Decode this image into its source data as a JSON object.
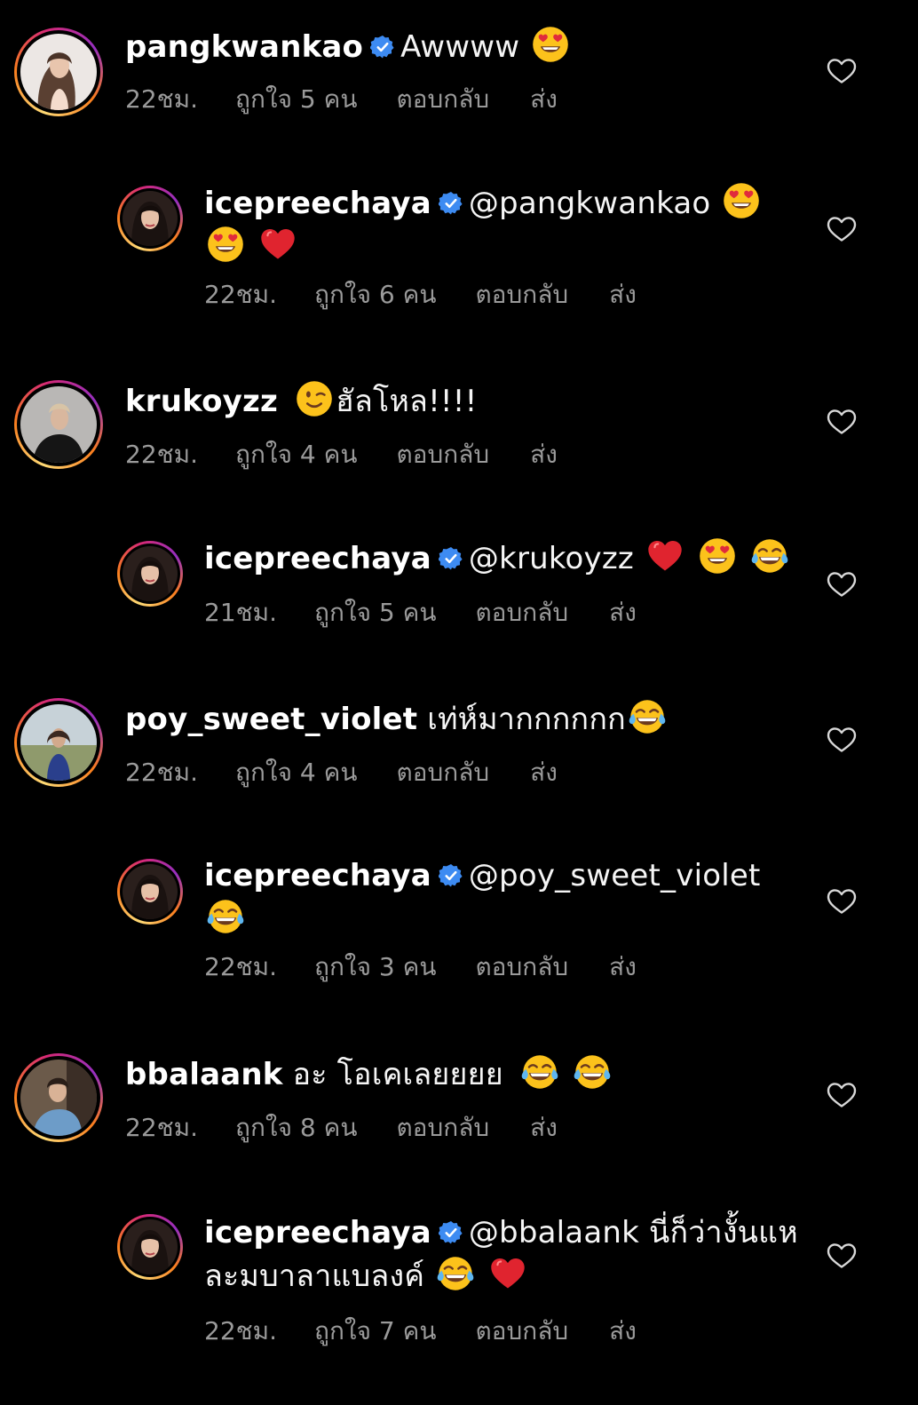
{
  "comments": [
    {
      "username": "pangkwankao",
      "verified": true,
      "text": "Awwww",
      "emojis_after": [
        "heart-eyes"
      ],
      "time": "22ชม.",
      "likes": "ถูกใจ 5 คน",
      "reply": "ตอบกลับ",
      "send": "ส่ง"
    },
    {
      "username": "icepreechaya",
      "verified": true,
      "text": "@pangkwankao",
      "emojis_after": [
        "heart-eyes",
        "heart-eyes",
        "red-heart"
      ],
      "time": "22ชม.",
      "likes": "ถูกใจ 6 คน",
      "reply": "ตอบกลับ",
      "send": "ส่ง"
    },
    {
      "username": "krukoyzz",
      "verified": false,
      "text": "ฮัลโหล!!!!",
      "emojis_before": [
        "winking-face"
      ],
      "time": "22ชม.",
      "likes": "ถูกใจ 4 คน",
      "reply": "ตอบกลับ",
      "send": "ส่ง"
    },
    {
      "username": "icepreechaya",
      "verified": true,
      "text": "@krukoyzz",
      "emojis_after": [
        "red-heart",
        "heart-eyes",
        "tears-of-joy"
      ],
      "time": "21ชม.",
      "likes": "ถูกใจ 5 คน",
      "reply": "ตอบกลับ",
      "send": "ส่ง"
    },
    {
      "username": "poy_sweet_violet",
      "verified": false,
      "text": "เท่ห์มากกกกกก",
      "emojis_after": [
        "tears-of-joy"
      ],
      "time": "22ชม.",
      "likes": "ถูกใจ 4 คน",
      "reply": "ตอบกลับ",
      "send": "ส่ง"
    },
    {
      "username": "icepreechaya",
      "verified": true,
      "text": "@poy_sweet_violet",
      "emojis_after": [
        "tears-of-joy"
      ],
      "time": "22ชม.",
      "likes": "ถูกใจ 3 คน",
      "reply": "ตอบกลับ",
      "send": "ส่ง"
    },
    {
      "username": "bbalaank",
      "verified": false,
      "text": "อะ โอเคเลยยยย",
      "emojis_after": [
        "tears-of-joy",
        "tears-of-joy"
      ],
      "time": "22ชม.",
      "likes": "ถูกใจ 8 คน",
      "reply": "ตอบกลับ",
      "send": "ส่ง"
    },
    {
      "username": "icepreechaya",
      "verified": true,
      "text_line1": "@bbalaank นี่ก็ว่างั้นแห",
      "text_line2": "ละมบาลาแบลงค์",
      "emojis_after": [
        "tears-of-joy",
        "red-heart"
      ],
      "time": "22ชม.",
      "likes": "ถูกใจ 7 คน",
      "reply": "ตอบกลับ",
      "send": "ส่ง"
    }
  ],
  "colors": {
    "background": "#000000",
    "username": "#ffffff",
    "meta": "#9a9a9a",
    "verified": "#3897f0"
  }
}
